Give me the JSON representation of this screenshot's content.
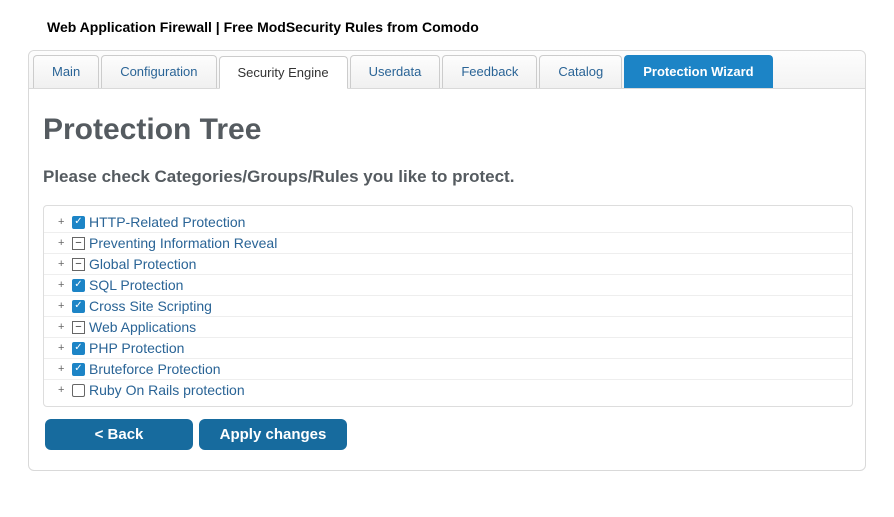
{
  "page_title": "Web Application Firewall | Free ModSecurity Rules from Comodo",
  "tabs": [
    {
      "label": "Main",
      "active_blue": false,
      "active_white": false
    },
    {
      "label": "Configuration",
      "active_blue": false,
      "active_white": false
    },
    {
      "label": "Security Engine",
      "active_blue": false,
      "active_white": true
    },
    {
      "label": "Userdata",
      "active_blue": false,
      "active_white": false
    },
    {
      "label": "Feedback",
      "active_blue": false,
      "active_white": false
    },
    {
      "label": "Catalog",
      "active_blue": false,
      "active_white": false
    },
    {
      "label": "Protection Wizard",
      "active_blue": true,
      "active_white": false
    }
  ],
  "heading": "Protection Tree",
  "subheading": "Please check Categories/Groups/Rules you like to protect.",
  "tree": [
    {
      "expand": "+",
      "control": "checkbox",
      "checked": true,
      "label": "HTTP-Related Protection"
    },
    {
      "expand": "+",
      "control": "statebox",
      "glyph": "−",
      "label": "Preventing Information Reveal"
    },
    {
      "expand": "+",
      "control": "statebox",
      "glyph": "−",
      "label": "Global Protection"
    },
    {
      "expand": "+",
      "control": "checkbox",
      "checked": true,
      "label": "SQL Protection"
    },
    {
      "expand": "+",
      "control": "checkbox",
      "checked": true,
      "label": "Cross Site Scripting"
    },
    {
      "expand": "+",
      "control": "statebox",
      "glyph": "−",
      "label": "Web Applications"
    },
    {
      "expand": "+",
      "control": "checkbox",
      "checked": true,
      "label": "PHP Protection"
    },
    {
      "expand": "+",
      "control": "checkbox",
      "checked": true,
      "label": "Bruteforce Protection"
    },
    {
      "expand": "+",
      "control": "checkbox",
      "checked": false,
      "label": "Ruby On Rails protection"
    }
  ],
  "buttons": {
    "back": "< Back",
    "apply": "Apply changes"
  }
}
